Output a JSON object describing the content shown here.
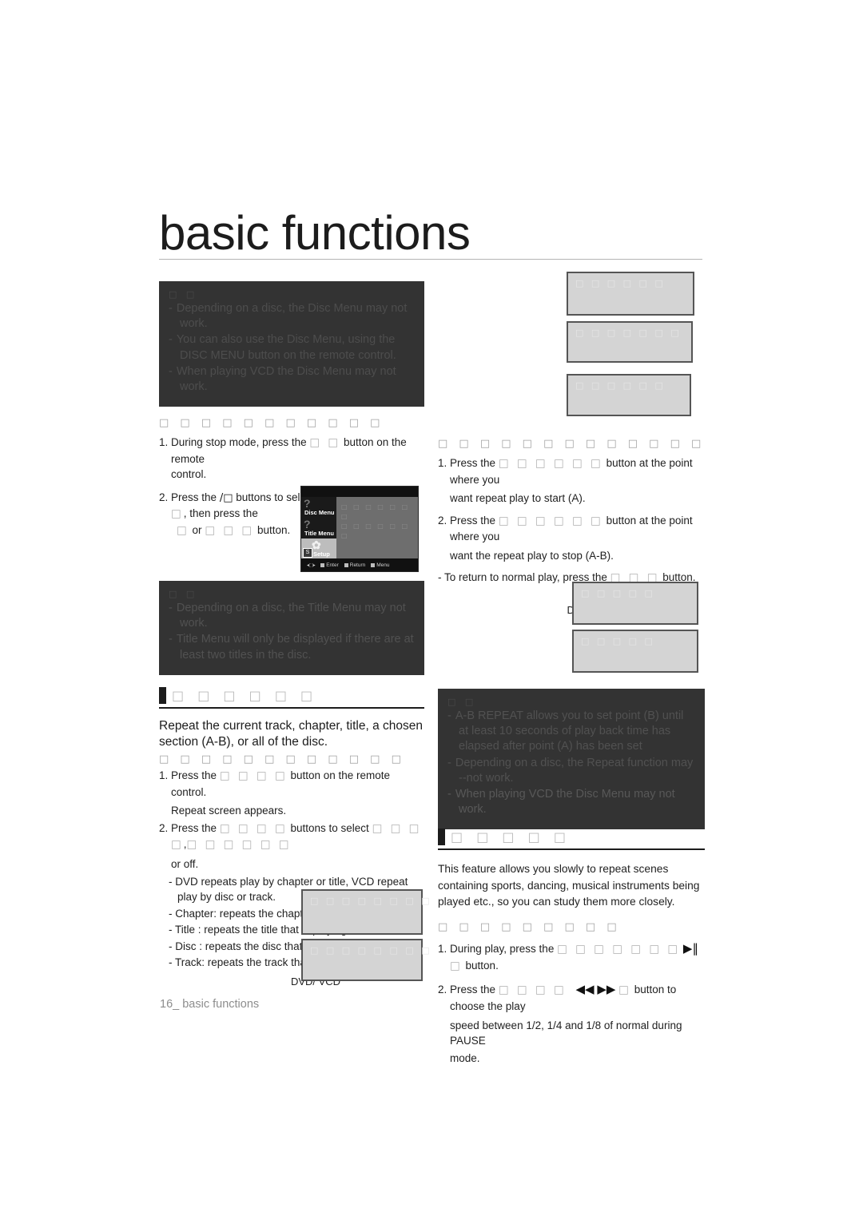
{
  "page": {
    "title": "basic functions",
    "footer": "16_ basic functions"
  },
  "left_column": {
    "note_disc_menu": {
      "title_tofu": "□ □",
      "bullets": [
        "Depending on a disc, the Disc Menu may not work.",
        "You can also use the Disc Menu, using the DISC MENU button on the remote control.",
        "When playing VCD the Disc Menu may not work."
      ]
    },
    "disc_menu_steps": {
      "sub_head_tofu": "□ □ □ □ □ □ □ □ □ □ □",
      "step1_pre": "1. During stop mode, press the",
      "step1_tofu": "□ □",
      "step1_post": "button on the remote",
      "step1_cont": "control.",
      "step2_pre": "2. Press the",
      "step2_arrows": "/□",
      "step2_mid": "buttons to select",
      "step2_tofu": "□ □ □ □ □ □",
      "step2_post": ", then press the",
      "step2_cont_tofu_a": "□",
      "step2_cont_or": "or",
      "step2_cont_tofu_b": "□ □ □",
      "step2_cont_post": "button."
    },
    "osd_menu": {
      "items": [
        {
          "label": "Disc Menu",
          "glyph": "?",
          "selected": true
        },
        {
          "label": "Title Menu",
          "glyph": "?",
          "selected": true
        },
        {
          "label": "Setup",
          "glyph": "✿",
          "badge": "S",
          "selected": false
        }
      ],
      "right_tofu_line1": "□ □ □ □ □ □ □",
      "right_tofu_line2": "□ □ □ □ □ □ □",
      "footer_items": [
        "Enter",
        "Return",
        "Menu"
      ],
      "dpad": "◂⬚▸"
    },
    "note_title_menu": {
      "title_tofu": "□ □",
      "bullets": [
        "Depending on a disc, the Title Menu may not work.",
        "Title Menu will only be displayed if there are at least two titles in the disc."
      ]
    },
    "repeat_section": {
      "head_tofu": "□ □ □ □ □ □",
      "lead": "Repeat the current track, chapter, title, a chosen section (A-B), or all of the disc.",
      "sub_head_tofu": "□ □ □ □ □ □ □ □ □ □ □ □",
      "step1_pre": "1. Press the",
      "step1_tofu": "□ □ □ □",
      "step1_post": "button on the remote control.",
      "step1_cont": "Repeat screen appears.",
      "step2_pre": "2. Press the",
      "step2_tofu": "□ □ □ □",
      "step2_mid": "buttons to select",
      "step2_tofu2": "□ □ □ □",
      "step2_comma": ",",
      "step2_tofu3": "□ □ □ □ □ □",
      "step2_cont": "or off.",
      "dashes": [
        "DVD repeats play by chapter or title, VCD repeat play by disc or track.",
        "Chapter: repeats the chapter that is playing.",
        "Title : repeats the title that is playing.",
        "Disc : repeats the disc that is playing.",
        "Track: repeats the track that is playing."
      ],
      "dvd_vcd_label": "DVD/ VCD",
      "image_box_1_label": "□ □ □ □ □ □ □ □",
      "image_box_2_label": "□ □ □ □ □ □ □ □"
    }
  },
  "right_column": {
    "top_boxes": [
      {
        "label": "□ □ □ □ □ □"
      },
      {
        "label": "□ □ □ □ □ □ □"
      },
      {
        "label": "□ □ □ □ □ □"
      }
    ],
    "ab_repeat": {
      "sub_head_tofu": "□ □ □ □ □ □ □ □ □ □ □ □ □",
      "step1_pre": "1. Press the",
      "step1_tofu": "□ □ □ □ □ □",
      "step1_post": "button at the point where you",
      "step1_cont": "want repeat play to start (A).",
      "step2_pre": "2. Press the",
      "step2_tofu": "□ □ □ □ □ □",
      "step2_post": "button at the point where you",
      "step2_cont": "want the repeat play to stop (A-B).",
      "dash_pre": "To return to normal play, press the",
      "dash_tofu": "□ □ □",
      "dash_post": "button.",
      "dvd_vcd_label": "DVD/ VCD",
      "image_box_1_label": "□ □ □ □ □",
      "image_box_2_label": "□ □ □ □ □"
    },
    "note_ab_repeat": {
      "title_tofu": "□ □",
      "bullets": [
        "A-B REPEAT allows you to set point (B) until at least 10 seconds of play back time has elapsed after point (A) has been set",
        "Depending on a disc, the Repeat function may --not work.",
        "When playing VCD the Disc Menu may not work."
      ]
    },
    "slow_section": {
      "head_tofu": "□ □ □ □ □",
      "body": "This feature allows you slowly to repeat scenes containing sports, dancing, musical instruments being played etc., so you can study them more closely.",
      "sub_head_tofu": "□ □ □ □ □ □ □ □ □",
      "step1_pre": "1. During play, press the",
      "step1_tofu": "□ □ □ □ □ □ □",
      "step1_glyph": "▶‖",
      "step1_tofu2": "□",
      "step1_post": "button.",
      "step2_pre": "2. Press the",
      "step2_tofu": "□ □ □ □",
      "step2_glyph_rew": "◀◀",
      "step2_glyph_ff": "▶▶",
      "step2_tofu2": "□",
      "step2_post": "button to choose the play",
      "step2_cont": "speed between 1/2, 1/4 and 1/8 of normal during PAUSE",
      "step2_cont2": "mode."
    }
  }
}
